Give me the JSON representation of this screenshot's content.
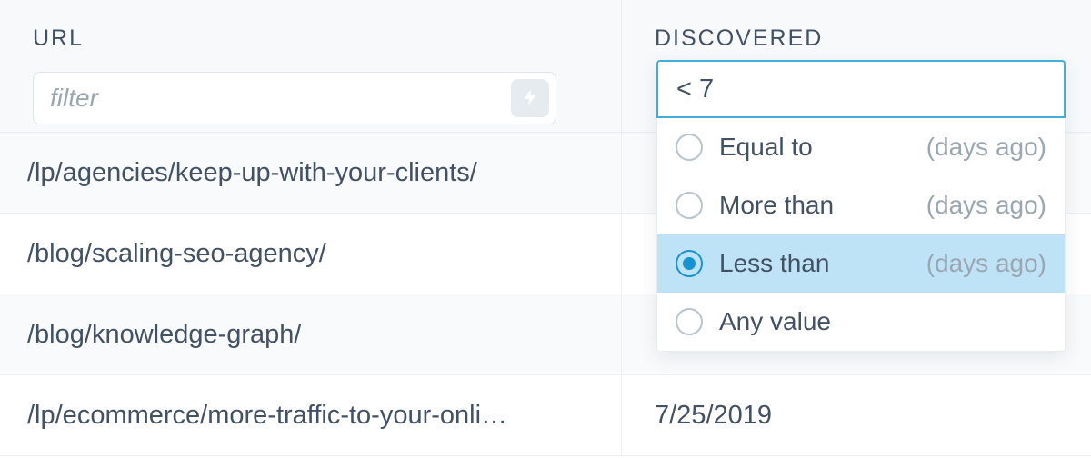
{
  "columns": {
    "url": {
      "label": "URL",
      "filter_placeholder": "filter",
      "filter_value": ""
    },
    "discovered": {
      "label": "DISCOVERED",
      "filter_value": "< 7",
      "options": [
        {
          "label": "Equal to",
          "hint": "(days ago)",
          "selected": false
        },
        {
          "label": "More than",
          "hint": "(days ago)",
          "selected": false
        },
        {
          "label": "Less than",
          "hint": "(days ago)",
          "selected": true
        },
        {
          "label": "Any value",
          "hint": "",
          "selected": false
        }
      ]
    }
  },
  "rows": [
    {
      "url": "/lp/agencies/keep-up-with-your-clients/",
      "discovered": ""
    },
    {
      "url": "/blog/scaling-seo-agency/",
      "discovered": ""
    },
    {
      "url": "/blog/knowledge-graph/",
      "discovered": ""
    },
    {
      "url": "/lp/ecommerce/more-traffic-to-your-onli…",
      "discovered": "7/25/2019"
    }
  ]
}
